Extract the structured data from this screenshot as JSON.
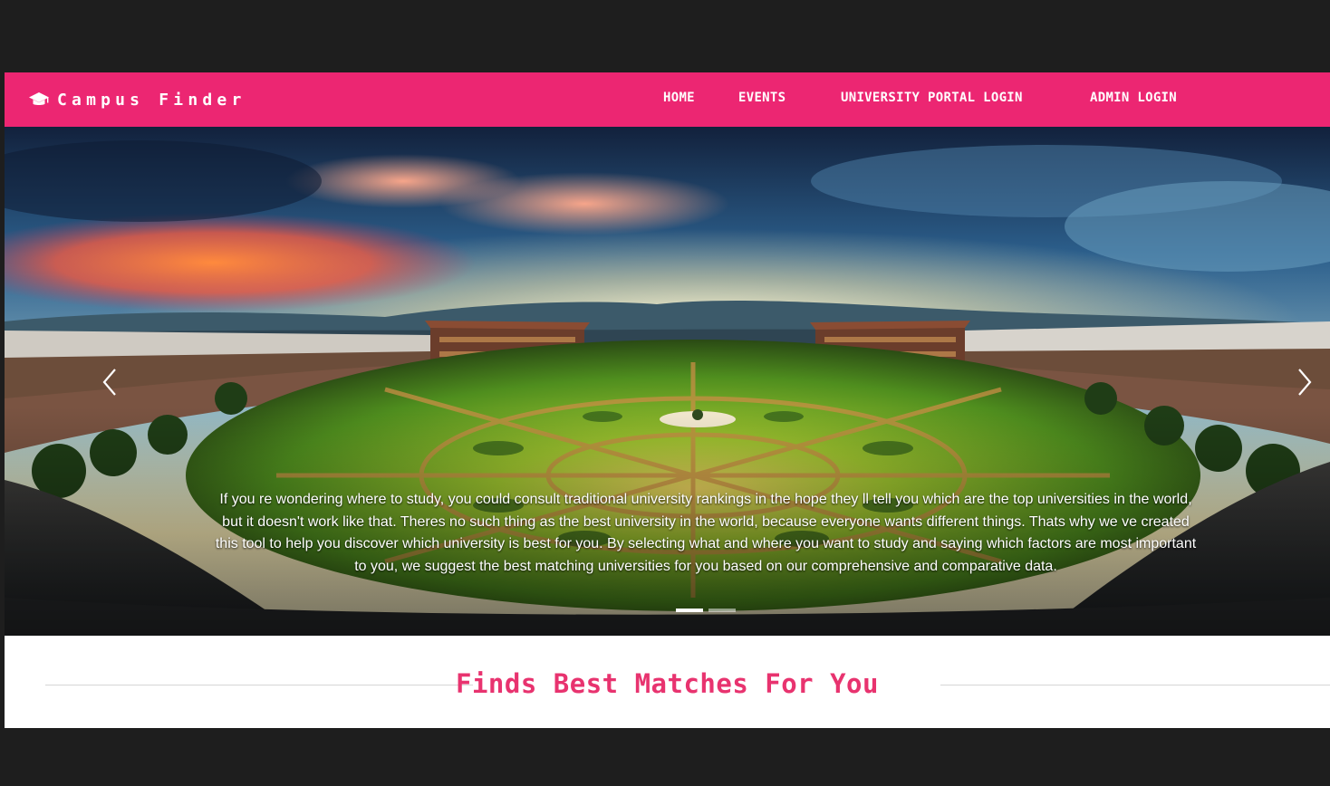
{
  "brand": {
    "icon": "graduation-cap-icon",
    "name": "Campus Finder"
  },
  "nav": {
    "home": "HOME",
    "events": "EVENTS",
    "portal_login": "UNIVERSITY PORTAL LOGIN",
    "admin_login": "ADMIN LOGIN"
  },
  "carousel": {
    "caption": "If you re wondering where to study, you could consult traditional university rankings in the hope they ll tell you which are the top universities in the world, but it doesn't work like that. Theres no such thing as the best university in the world, because everyone wants different things. Thats why we ve created this tool to help you discover which university is best for you. By selecting what and where you want to study and saying which factors are most important to you, we suggest the best matching universities for you based on our comprehensive and comparative data.",
    "prev_icon": "chevron-left-icon",
    "next_icon": "chevron-right-icon",
    "slide_count": 2,
    "active_slide": 1
  },
  "section": {
    "title": "Finds Best Matches For You"
  },
  "colors": {
    "brand_pink": "#ec2672",
    "title_pink": "#e8336f",
    "outer_background": "#1e1e1e"
  }
}
